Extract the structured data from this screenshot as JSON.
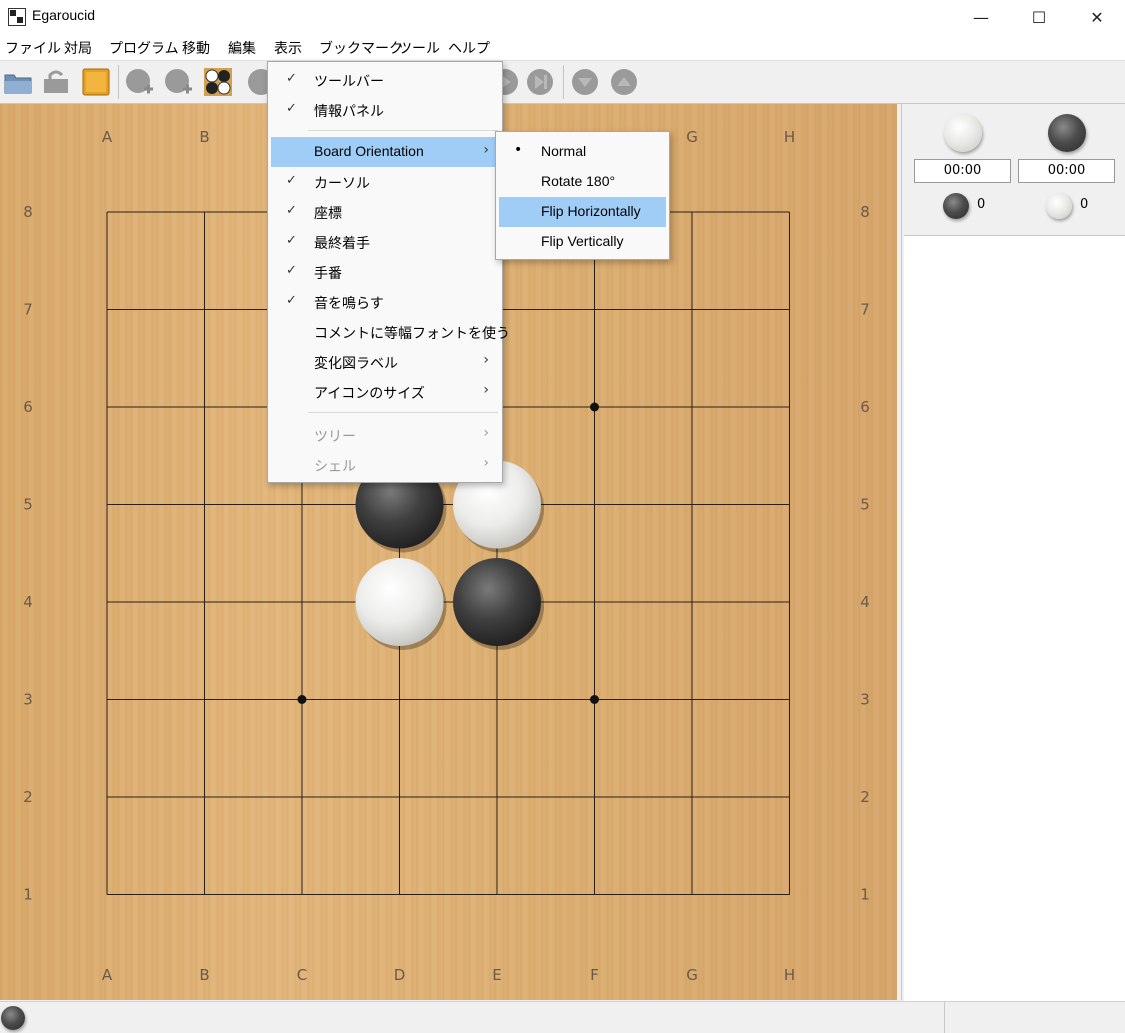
{
  "window": {
    "title": "Egaroucid",
    "minimize": "—",
    "maximize": "☐",
    "close": "✕"
  },
  "menubar": {
    "items": [
      "ファイル",
      "対局",
      "プログラム",
      "移動",
      "編集",
      "表示",
      "ブックマーク",
      "ツール",
      "ヘルプ"
    ]
  },
  "board": {
    "columns": [
      "A",
      "B",
      "C",
      "D",
      "E",
      "F",
      "G",
      "H"
    ],
    "rows": [
      "8",
      "7",
      "6",
      "5",
      "4",
      "3",
      "2",
      "1"
    ],
    "stones": [
      {
        "pos": "D5",
        "color": "black"
      },
      {
        "pos": "E5",
        "color": "white"
      },
      {
        "pos": "D4",
        "color": "white"
      },
      {
        "pos": "E4",
        "color": "black"
      }
    ],
    "star_points": [
      "F6",
      "C3",
      "F3"
    ],
    "colors": {
      "wood": "#dcae70",
      "line": "#2a2018",
      "coord": "#6a5a47"
    }
  },
  "info_panel": {
    "white_timer": "00:00",
    "black_timer": "00:00",
    "black_count": "0",
    "white_count": "0"
  },
  "view_menu": {
    "items": [
      {
        "label": "ツールバー",
        "checked": true
      },
      {
        "label": "情報パネル",
        "checked": true
      },
      {
        "label": "Board Orientation",
        "submenu": true,
        "highlight": true
      },
      {
        "label": "カーソル",
        "checked": true
      },
      {
        "label": "座標",
        "checked": true
      },
      {
        "label": "最終着手",
        "checked": true
      },
      {
        "label": "手番",
        "checked": true
      },
      {
        "label": "音を鳴らす",
        "checked": true
      },
      {
        "label": "コメントに等幅フォントを使う",
        "checked": false
      },
      {
        "label": "変化図ラベル",
        "submenu": true
      },
      {
        "label": "アイコンのサイズ",
        "submenu": true
      },
      {
        "label": "ツリー",
        "submenu": true,
        "disabled": true
      },
      {
        "label": "シェル",
        "submenu": true,
        "disabled": true
      }
    ],
    "check_glyph": "✓",
    "arrow_glyph": "›"
  },
  "orientation_menu": {
    "items": [
      {
        "label": "Normal",
        "selected": true
      },
      {
        "label": "Rotate 180°",
        "selected": false
      },
      {
        "label": "Flip Horizontally",
        "selected": false,
        "highlight": true
      },
      {
        "label": "Flip Vertically",
        "selected": false
      }
    ],
    "bullet_glyph": "•"
  },
  "toolbar": {
    "icons": [
      "open-folder-icon",
      "open-web-icon",
      "engine-icon",
      "add-white-stone-icon",
      "add-black-stone-icon",
      "pattern-icon"
    ]
  },
  "accent": "#9fcdf6"
}
